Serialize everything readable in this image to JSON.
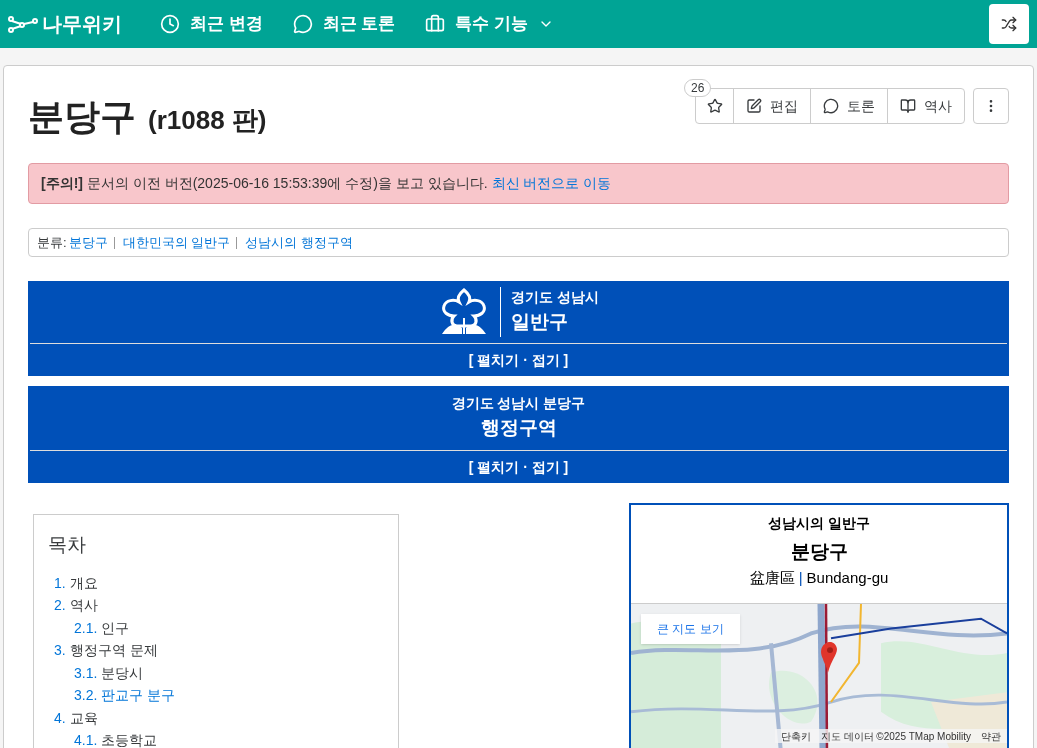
{
  "navbar": {
    "logo": "나무위키",
    "links": [
      {
        "label": "최근 변경",
        "dropdown": false
      },
      {
        "label": "최근 토론",
        "dropdown": false
      },
      {
        "label": "특수 기능",
        "dropdown": true
      }
    ]
  },
  "article": {
    "title": "분당구",
    "revision": "(r1088 판)",
    "star_count": "26",
    "actions": [
      {
        "label": "편집"
      },
      {
        "label": "토론"
      },
      {
        "label": "역사"
      }
    ]
  },
  "notice": {
    "label": "[주의!]",
    "text": "문서의 이전 버전(2025-06-16 15:53:39에 수정)을 보고 있습니다.",
    "link": "최신 버전으로 이동"
  },
  "categories": {
    "label": "분류:",
    "items": [
      "분당구",
      "대한민국의 일반구",
      "성남시의 행정구역"
    ]
  },
  "banners": [
    {
      "kind": "emblem",
      "subtitle": "경기도 성남시",
      "title": "일반구",
      "toggle": "[ 펼치기 · 접기 ]"
    },
    {
      "kind": "plain",
      "subtitle": "경기도 성남시 분당구",
      "title": "행정구역",
      "toggle": "[ 펼치기 · 접기 ]"
    }
  ],
  "toc": {
    "title": "목차",
    "items": [
      {
        "number": "1.",
        "label": "개요",
        "highlighted": false
      },
      {
        "number": "2.",
        "label": "역사",
        "highlighted": false,
        "children": [
          {
            "number": "2.1.",
            "label": "인구",
            "highlighted": false
          }
        ]
      },
      {
        "number": "3.",
        "label": "행정구역 문제",
        "highlighted": false,
        "children": [
          {
            "number": "3.1.",
            "label": "분당시",
            "highlighted": false
          },
          {
            "number": "3.2.",
            "label": "판교구 분구",
            "highlighted": true
          }
        ]
      },
      {
        "number": "4.",
        "label": "교육",
        "highlighted": false,
        "children": [
          {
            "number": "4.1.",
            "label": "초등학교",
            "highlighted": false
          }
        ]
      }
    ]
  },
  "infobox": {
    "caption": "성남시의 일반구",
    "name": "분당구",
    "hanja": "盆唐區",
    "separator": "|",
    "roman": "Bundang-gu",
    "map": {
      "kind": "picture",
      "button": "큰 지도 보기",
      "footer": [
        "단축키",
        "지도 데이터 ©2025 TMap Mobility",
        "약관"
      ]
    }
  }
}
